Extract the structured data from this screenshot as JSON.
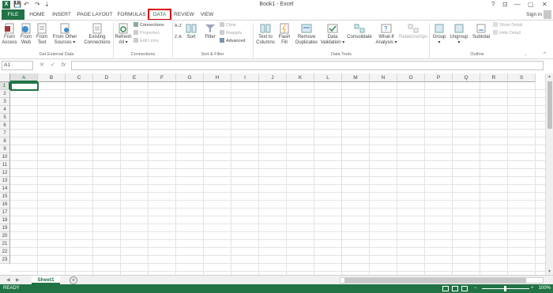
{
  "window": {
    "title": "Book1 - Excel",
    "app_logo": "X",
    "qat": {
      "save": "💾",
      "undo": "↶",
      "redo": "↷",
      "customize": "⇣"
    },
    "controls": {
      "help": "?",
      "ribbon_options": "⊡",
      "minimize": "—",
      "restore": "▢",
      "close": "✕"
    }
  },
  "tabs": {
    "file": "FILE",
    "items": [
      "HOME",
      "INSERT",
      "PAGE LAYOUT",
      "FORMULAS",
      "DATA",
      "REVIEW",
      "VIEW"
    ],
    "active": "DATA",
    "signin": "Sign in"
  },
  "ribbon": {
    "get_external_data": {
      "label": "Get External Data",
      "from_access": [
        "From",
        "Access"
      ],
      "from_web": [
        "From",
        "Web"
      ],
      "from_text": [
        "From",
        "Text"
      ],
      "from_other": [
        "From Other",
        "Sources ▾"
      ],
      "existing": [
        "Existing",
        "Connections"
      ]
    },
    "connections": {
      "label": "Connections",
      "refresh": [
        "Refresh",
        "All ▾"
      ],
      "connections": "Connections",
      "properties": "Properties",
      "edit_links": "Edit Links"
    },
    "sort_filter": {
      "label": "Sort & Filter",
      "az": "A↓Z",
      "za": "Z↓A",
      "sort": "Sort",
      "filter": "Filter",
      "clear": "Clear",
      "reapply": "Reapply",
      "advanced": "Advanced"
    },
    "data_tools": {
      "label": "Data Tools",
      "text_to_columns": [
        "Text to",
        "Columns"
      ],
      "flash_fill": [
        "Flash",
        "Fill"
      ],
      "remove_duplicates": [
        "Remove",
        "Duplicates"
      ],
      "data_validation": [
        "Data",
        "Validation ▾"
      ],
      "consolidate": "Consolidate",
      "what_if": [
        "What-If",
        "Analysis ▾"
      ],
      "relationships": "Relationships"
    },
    "outline": {
      "label": "Outline",
      "group": [
        "Group",
        "▾"
      ],
      "ungroup": [
        "Ungroup",
        "▾"
      ],
      "subtotal": "Subtotal",
      "show_detail": "Show Detail",
      "hide_detail": "Hide Detail"
    }
  },
  "formula_bar": {
    "name_box": "A1",
    "cancel": "✕",
    "enter": "✓",
    "fx": "fx",
    "formula_value": ""
  },
  "grid": {
    "columns": [
      "A",
      "B",
      "C",
      "D",
      "E",
      "F",
      "G",
      "H",
      "I",
      "J",
      "K",
      "L",
      "M",
      "N",
      "O",
      "P",
      "Q",
      "R",
      "S"
    ],
    "rows": [
      "1",
      "2",
      "3",
      "4",
      "5",
      "6",
      "7",
      "8",
      "9",
      "10",
      "11",
      "12",
      "13",
      "14",
      "15",
      "16",
      "17",
      "18",
      "19",
      "20",
      "21",
      "22",
      "23"
    ],
    "active_cell": "A1"
  },
  "sheets": {
    "nav_prev": "◀",
    "nav_next": "▶",
    "tabs": [
      "Sheet1"
    ],
    "active": "Sheet1",
    "add": "+"
  },
  "status": {
    "ready": "READY",
    "zoom_minus": "−",
    "zoom_plus": "+",
    "zoom": "100%"
  },
  "colors": {
    "accent": "#217346",
    "highlight_outline": "#dd0000"
  }
}
